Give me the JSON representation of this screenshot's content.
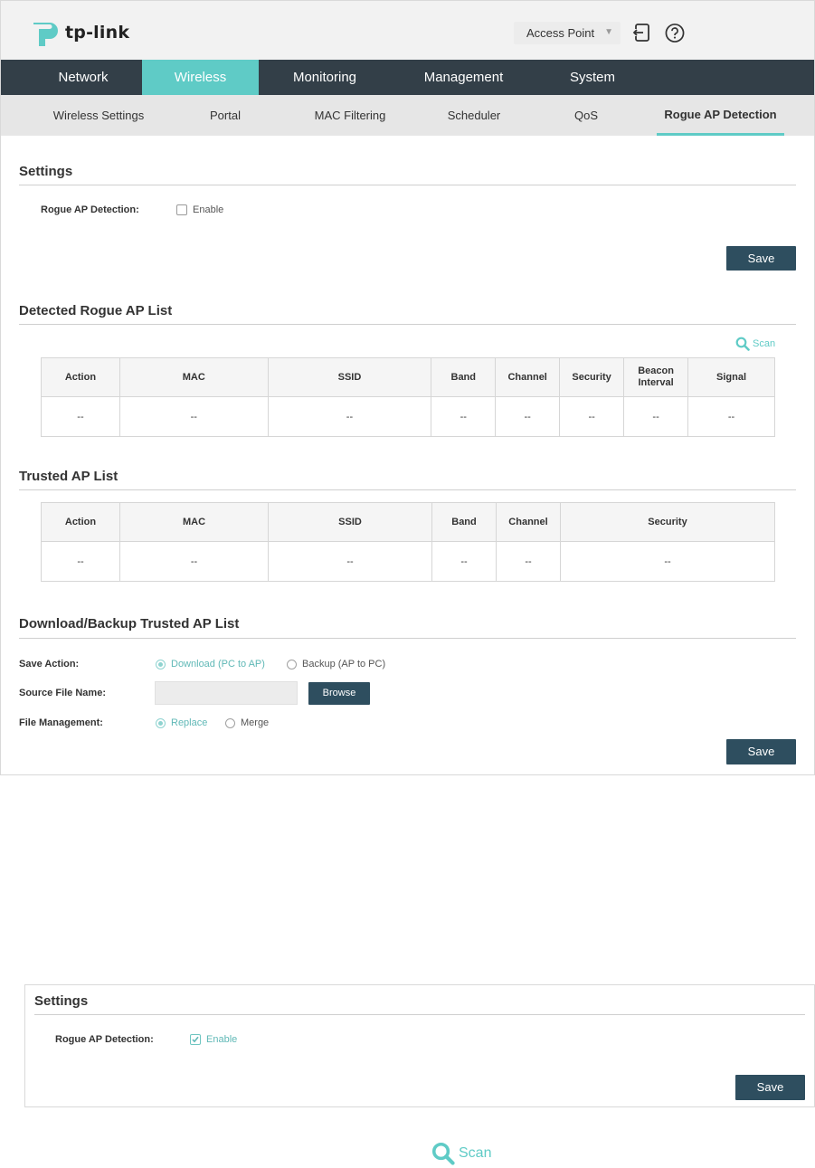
{
  "header": {
    "logo_text": "tp-link",
    "mode_select": "Access Point",
    "logout_icon": "logout-icon",
    "help_icon": "help-icon"
  },
  "main_nav": [
    "Network",
    "Wireless",
    "Monitoring",
    "Management",
    "System"
  ],
  "main_nav_active": "Wireless",
  "sub_nav": [
    "Wireless Settings",
    "Portal",
    "MAC Filtering",
    "Scheduler",
    "QoS",
    "Rogue AP Detection"
  ],
  "sub_nav_active": "Rogue AP Detection",
  "settings": {
    "title": "Settings",
    "rogue_label": "Rogue AP Detection:",
    "enable_label": "Enable",
    "enable_checked": false,
    "save_label": "Save"
  },
  "detected": {
    "title": "Detected Rogue AP List",
    "scan_label": "Scan",
    "columns": [
      "Action",
      "MAC",
      "SSID",
      "Band",
      "Channel",
      "Security",
      "Beacon Interval",
      "Signal"
    ],
    "rows": [
      [
        "--",
        "--",
        "--",
        "--",
        "--",
        "--",
        "--",
        "--"
      ]
    ]
  },
  "trusted": {
    "title": "Trusted AP List",
    "columns": [
      "Action",
      "MAC",
      "SSID",
      "Band",
      "Channel",
      "Security"
    ],
    "rows": [
      [
        "--",
        "--",
        "--",
        "--",
        "--",
        "--"
      ]
    ]
  },
  "download": {
    "title": "Download/Backup Trusted AP List",
    "save_action_label": "Save Action:",
    "save_action_options": [
      "Download (PC to AP)",
      "Backup (AP to PC)"
    ],
    "save_action_selected": "Download (PC to AP)",
    "source_file_label": "Source File Name:",
    "source_file_value": "",
    "browse_label": "Browse",
    "file_mgmt_label": "File Management:",
    "file_mgmt_options": [
      "Replace",
      "Merge"
    ],
    "file_mgmt_selected": "Replace",
    "save_label": "Save"
  },
  "snippet": {
    "title": "Settings",
    "rogue_label": "Rogue AP Detection:",
    "enable_label": "Enable",
    "enable_checked": true,
    "save_label": "Save"
  },
  "scan_large": {
    "label": "Scan"
  },
  "colors": {
    "accent": "#5fcbc6",
    "nav_bg": "#333f48",
    "button_bg": "#2e4e5f"
  }
}
